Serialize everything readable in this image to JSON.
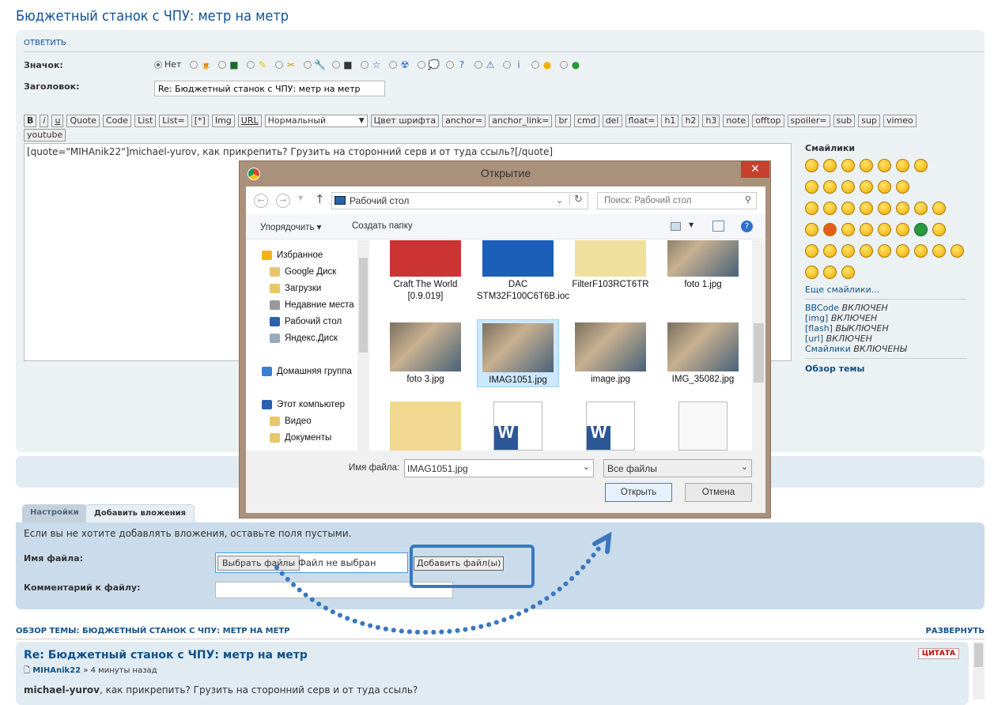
{
  "page_title": "Бюджетный станок с ЧПУ: метр на метр",
  "reply": {
    "header": "ОТВЕТИТЬ",
    "icon_label": "Значок:",
    "icon_none": "Нет",
    "icon_options": [
      "beer-icon",
      "circuit-board-icon",
      "lightbulb-icon",
      "pliers-icon",
      "wrench-icon",
      "motor-icon",
      "star-icon",
      "radioactive-icon",
      "speech-bubble-icon",
      "question-icon",
      "warning-icon",
      "info-icon",
      "wink-smiley-icon",
      "grin-smiley-icon"
    ],
    "subject_label": "Заголовок:",
    "subject_value": "Re: Бюджетный станок с ЧПУ: метр на метр",
    "bbcode_buttons": [
      "B",
      "i",
      "u",
      "Quote",
      "Code",
      "List",
      "List=",
      "[*]",
      "Img",
      "URL"
    ],
    "font_size_select": "Нормальный",
    "bbcode_buttons2": [
      "Цвет шрифта",
      "anchor=",
      "anchor_link=",
      "br",
      "cmd",
      "del",
      "float=",
      "h1",
      "h2",
      "h3",
      "note",
      "offtop",
      "spoiler=",
      "sub",
      "sup",
      "vimeo",
      "youtube"
    ],
    "message": "[quote=\"MIHAnik22\"]michael-yurov, как прикрепить? Грузить на сторонний серв и от туда ссыль?[/quote]"
  },
  "sidebar": {
    "smilies_title": "Смайлики",
    "more_smilies": "Еще смайлики...",
    "status": [
      {
        "name": "BBCode",
        "state": "ВКЛЮЧЕН"
      },
      {
        "name": "[img]",
        "state": "ВКЛЮЧЕН"
      },
      {
        "name": "[flash]",
        "state": "ВЫКЛЮЧЕН"
      },
      {
        "name": "[url]",
        "state": "ВКЛЮЧЕН"
      },
      {
        "name": "Смайлики",
        "state": "ВКЛЮЧЕНЫ"
      }
    ],
    "topic_review_link": "Обзор темы"
  },
  "tabs": [
    {
      "label": "Настройки",
      "active": false
    },
    {
      "label": "Добавить вложения",
      "active": true
    }
  ],
  "attachments": {
    "hint": "Если вы не хотите добавлять вложения, оставьте поля пустыми.",
    "file_label": "Имя файла:",
    "choose_button": "Выбрать файлы",
    "no_file": "Файл не выбран",
    "add_button": "Добавить файл(ы)",
    "comment_label": "Комментарий к файлу:"
  },
  "review": {
    "header": "ОБЗОР ТЕМЫ: БЮДЖЕТНЫЙ СТАНОК С ЧПУ: МЕТР НА МЕТР",
    "expand": "РАЗВЕРНУТЬ",
    "post_title": "Re: Бюджетный станок с ЧПУ: метр на метр",
    "quote_button": "ЦИТАТА",
    "author": "MIHAnik22",
    "time": "» 4 минуты назад",
    "mention": "michael-yurov",
    "text": ", как прикрепить? Грузить на сторонний серв и от туда ссыль?"
  },
  "dialog": {
    "title": "Открытие",
    "location": "Рабочий стол",
    "search_placeholder": "Поиск: Рабочий стол",
    "organize": "Упорядочить ▾",
    "new_folder": "Создать папку",
    "nav": [
      {
        "label": "Избранное",
        "icon": "star-icon",
        "level": 0
      },
      {
        "label": "Google Диск",
        "icon": "folder-icon",
        "level": 1
      },
      {
        "label": "Загрузки",
        "icon": "downloads-icon",
        "level": 1
      },
      {
        "label": "Недавние места",
        "icon": "recent-icon",
        "level": 1
      },
      {
        "label": "Рабочий стол",
        "icon": "desktop-icon",
        "level": 1
      },
      {
        "label": "Яндекс.Диск",
        "icon": "cloud-icon",
        "level": 1
      },
      {
        "label": "",
        "icon": "",
        "level": 0
      },
      {
        "label": "Домашняя группа",
        "icon": "homegroup-icon",
        "level": 0
      },
      {
        "label": "",
        "icon": "",
        "level": 0
      },
      {
        "label": "Этот компьютер",
        "icon": "computer-icon",
        "level": 0
      },
      {
        "label": "Видео",
        "icon": "video-folder-icon",
        "level": 1
      },
      {
        "label": "Документы",
        "icon": "documents-folder-icon",
        "level": 1
      }
    ],
    "files": [
      {
        "name": "Craft The World [0.9.019]",
        "type": "shortcut"
      },
      {
        "name": "DAC STM32F100C6T6B.ioc",
        "type": "ioc"
      },
      {
        "name": "FilterF103RCT6TR",
        "type": "shortcut-folder"
      },
      {
        "name": "foto 1.jpg",
        "type": "image"
      },
      {
        "name": "foto 3.jpg",
        "type": "image"
      },
      {
        "name": "IMAG1051.jpg",
        "type": "image",
        "selected": true
      },
      {
        "name": "image.jpg",
        "type": "image"
      },
      {
        "name": "IMG_35082.jpg",
        "type": "image"
      },
      {
        "name": "",
        "type": "pdf-folder"
      },
      {
        "name": "",
        "type": "word"
      },
      {
        "name": "",
        "type": "word"
      },
      {
        "name": "",
        "type": "text"
      }
    ],
    "filename_label": "Имя файла:",
    "filename_value": "IMAG1051.jpg",
    "filter": "Все файлы",
    "open": "Открыть",
    "cancel": "Отмена"
  },
  "colors": {
    "link": "#105289",
    "panel": "#ECF1F3",
    "attach_panel": "#CADCEB",
    "dialog_frame": "#A9917C",
    "annotation": "#3A78BE",
    "close": "#C7402F"
  }
}
